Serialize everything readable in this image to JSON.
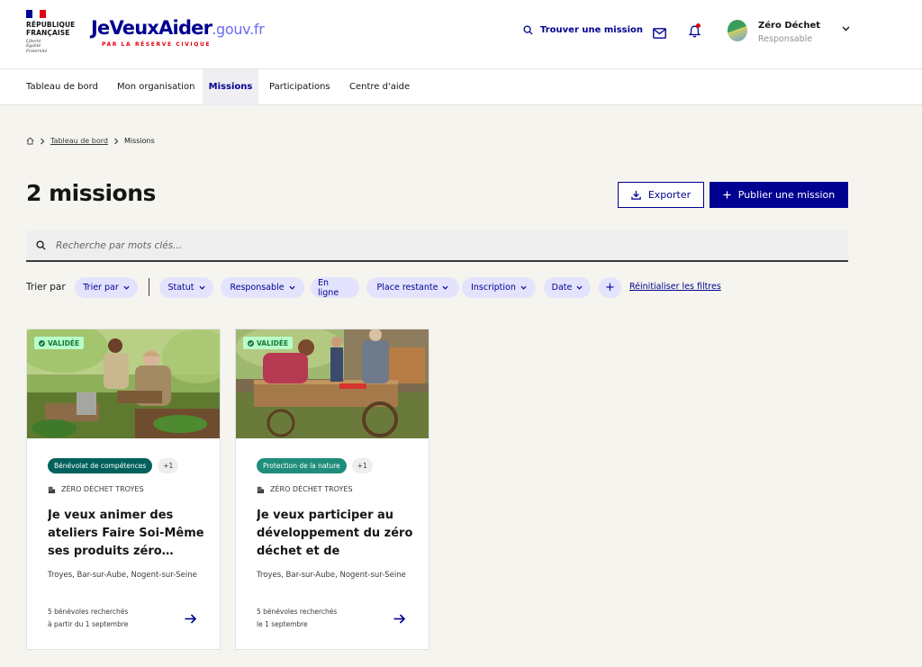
{
  "header": {
    "republic_lines": [
      "RÉPUBLIQUE",
      "FRANÇAISE"
    ],
    "motto_lines": [
      "Liberté",
      "Égalité",
      "Fraternité"
    ],
    "brand_main": "JeVeuxAider",
    "brand_suffix": ".gouv.fr",
    "brand_tagline": "PAR LA RÉSERVE CIVIQUE",
    "find_mission": "Trouver une mission",
    "org_name": "Zéro Déchet",
    "org_role": "Responsable"
  },
  "nav": {
    "items": [
      "Tableau de bord",
      "Mon organisation",
      "Missions",
      "Participations",
      "Centre d'aide"
    ],
    "active": "Missions"
  },
  "breadcrumb": {
    "link": "Tableau de bord",
    "current": "Missions"
  },
  "page": {
    "title": "2 missions",
    "export_label": "Exporter",
    "publish_label": "Publier une mission",
    "search_placeholder": "Recherche par mots clés..."
  },
  "filters": {
    "sort_label": "Trier par",
    "sort_pill": "Trier par",
    "pills": [
      "Statut",
      "Responsable",
      "En ligne",
      "Place restante",
      "Inscription",
      "Date"
    ],
    "add": "+",
    "reset": "Réinitialiser les filtres"
  },
  "cards": [
    {
      "status": "VALIDÉE",
      "tag": "Bénévolat de compétences",
      "tag_color": "#00605b",
      "tag_more": "+1",
      "org": "ZÉRO DÉCHET TROYES",
      "title": "Je veux animer des ateliers Faire Soi-Même ses produits zéro…",
      "location": "Troyes, Bar-sur-Aube, Nogent-sur-Seine",
      "volunteers": "5 bénévoles recherchés",
      "date": "à partir du 1 septembre"
    },
    {
      "status": "VALIDÉE",
      "tag": "Protection de la nature",
      "tag_color": "#1f8d7b",
      "tag_more": "+1",
      "org": "ZÉRO DÉCHET TROYES",
      "title": "Je veux participer au développement du zéro déchet et de l'économ…",
      "location": "Troyes, Bar-sur-Aube, Nogent-sur-Seine",
      "volunteers": "5 bénévoles recherchés",
      "date": "le 1 septembre"
    }
  ],
  "colors": {
    "primary": "#000091",
    "validated_bg": "#b8fec9",
    "validated_fg": "#18753c",
    "accent_red": "#e1000f"
  }
}
